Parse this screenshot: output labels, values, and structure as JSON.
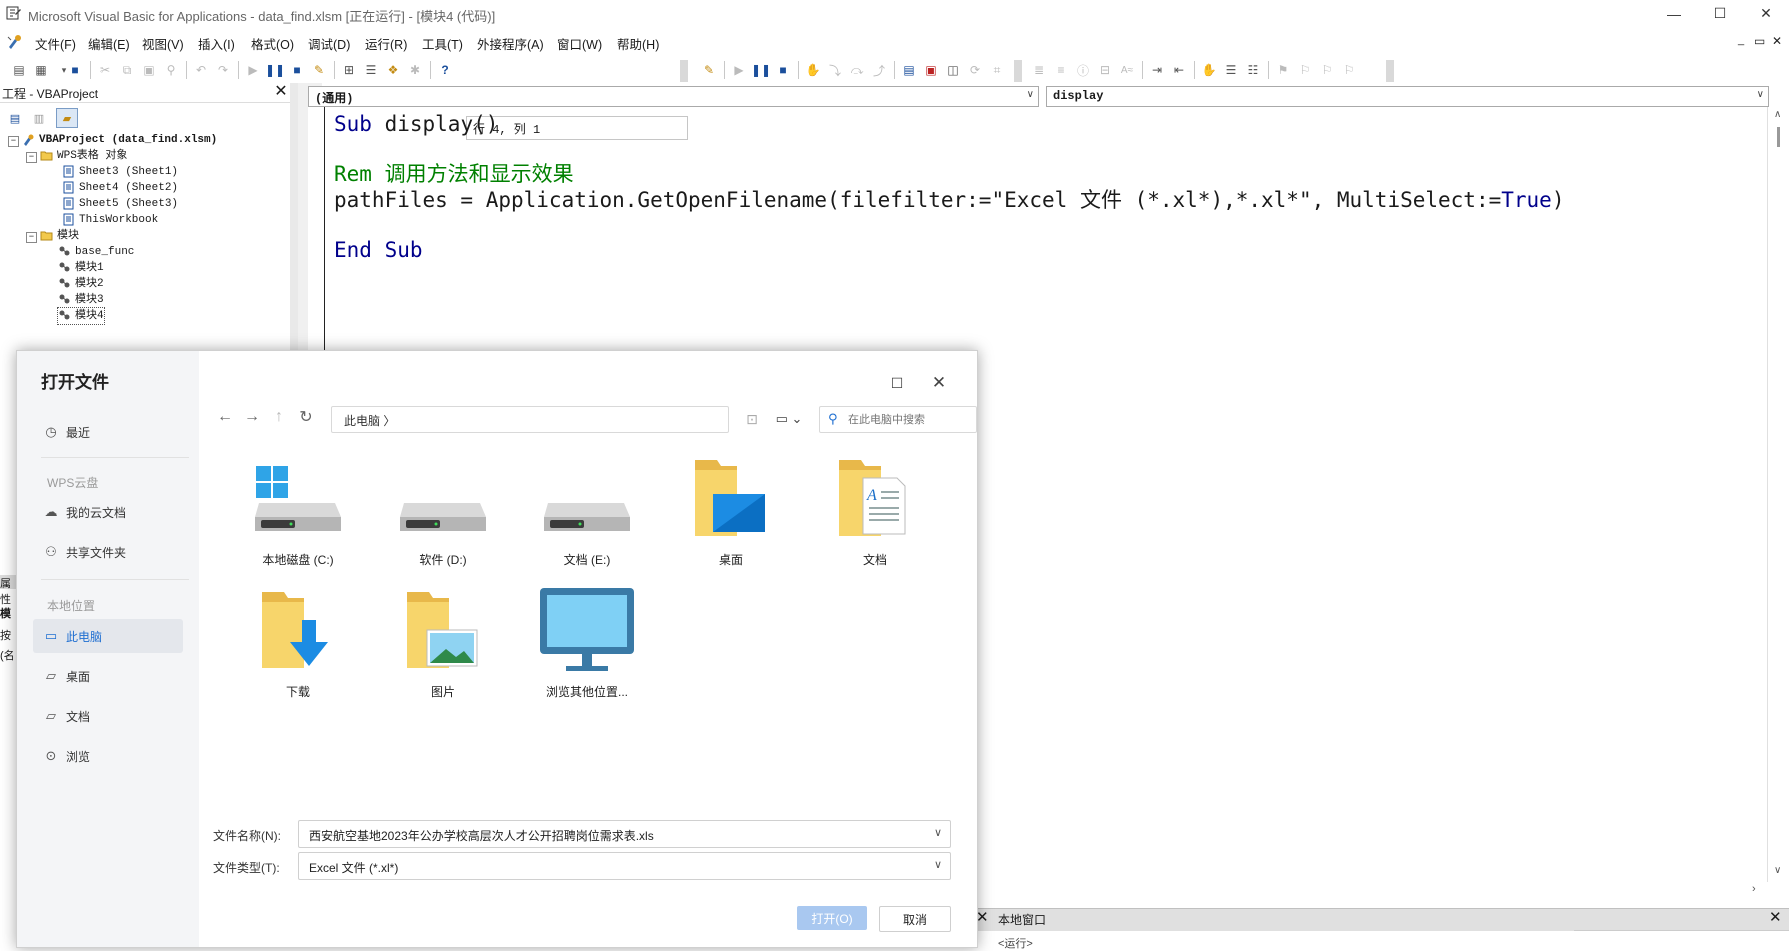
{
  "window": {
    "title": "Microsoft Visual Basic for Applications - data_find.xlsm [正在运行] - [模块4 (代码)]",
    "min_glyph": "—",
    "max_glyph": "☐",
    "close_glyph": "✕"
  },
  "menu": {
    "items": [
      "文件(F)",
      "编辑(E)",
      "视图(V)",
      "插入(I)",
      "格式(O)",
      "调试(D)",
      "运行(R)",
      "工具(T)",
      "外接程序(A)",
      "窗口(W)",
      "帮助(H)"
    ],
    "mdi_restore": "▭",
    "mdi_min": "_",
    "mdi_close": "✕"
  },
  "toolbar": {
    "position": "行 4, 列 1"
  },
  "project": {
    "header": "工程 - VBAProject",
    "close_glyph": "✕",
    "tree": [
      {
        "label": "VBAProject (data_find.xlsm)",
        "bold": true
      },
      {
        "label": "WPS表格 对象"
      },
      {
        "label": "Sheet3 (Sheet1)"
      },
      {
        "label": "Sheet4 (Sheet2)"
      },
      {
        "label": "Sheet5 (Sheet3)"
      },
      {
        "label": "ThisWorkbook"
      },
      {
        "label": "模块"
      },
      {
        "label": "base_func"
      },
      {
        "label": "模块1"
      },
      {
        "label": "模块2"
      },
      {
        "label": "模块3"
      },
      {
        "label": "模块4"
      }
    ]
  },
  "code": {
    "object_dropdown": "(通用)",
    "proc_dropdown": "display",
    "line1_kw": "Sub",
    "line1_rest": " display()",
    "line3_comment": "Rem 调用方法和显示效果",
    "line4_a": "pathFiles = Application.GetOpenFilename(filefilter:=\"Excel 文件 (*.xl*),*.xl*\", MultiSelect:=",
    "line4_kw": "True",
    "line4_b": ")",
    "line6": "End Sub"
  },
  "props_stub": [
    "属性",
    "模",
    "按",
    "(名"
  ],
  "locals": {
    "title": "本地窗口",
    "status": "<运行>"
  },
  "dialog": {
    "title": "打开文件",
    "sidebar": {
      "recent": "最近",
      "cloud_group": "WPS云盘",
      "my_cloud": "我的云文档",
      "shared": "共享文件夹",
      "local_group": "本地位置",
      "this_pc": "此电脑",
      "desktop": "桌面",
      "documents": "文档",
      "browse": "浏览"
    },
    "address": "此电脑 〉",
    "search_placeholder": "在此电脑中搜索",
    "tiles": [
      {
        "label": "本地磁盘 (C:)",
        "icon": "windows-drive-icon"
      },
      {
        "label": "软件 (D:)",
        "icon": "drive-icon"
      },
      {
        "label": "文档 (E:)",
        "icon": "drive-icon"
      },
      {
        "label": "桌面",
        "icon": "desktop-folder-icon"
      },
      {
        "label": "文档",
        "icon": "documents-folder-icon"
      },
      {
        "label": "下载",
        "icon": "downloads-folder-icon"
      },
      {
        "label": "图片",
        "icon": "pictures-folder-icon"
      },
      {
        "label": "浏览其他位置...",
        "icon": "monitor-icon"
      }
    ],
    "filename_label": "文件名称(N):",
    "filename_value": "西安航空基地2023年公办学校高层次人才公开招聘岗位需求表.xls",
    "filetype_label": "文件类型(T):",
    "filetype_value": "Excel 文件 (*.xl*)",
    "open_label": "打开(O)",
    "cancel_label": "取消"
  },
  "colors": {
    "keyword": "#00008b",
    "comment": "#008000",
    "accent": "#1f6fd1",
    "open_button": "#a9c8f0"
  }
}
